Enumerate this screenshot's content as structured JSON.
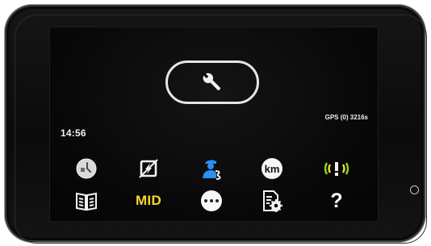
{
  "status": {
    "time": "14:56",
    "gps": "GPS (0) 3216s"
  },
  "main_button": {
    "icon": "wrench-icon"
  },
  "menu": {
    "row1": [
      {
        "icon": "clock-icon"
      },
      {
        "icon": "battery-disabled-icon"
      },
      {
        "icon": "driver-card-icon"
      },
      {
        "label": "km"
      },
      {
        "icon": "vibration-alert-icon"
      }
    ],
    "row2": [
      {
        "icon": "book-icon"
      },
      {
        "label": "MID"
      },
      {
        "icon": "more-icon"
      },
      {
        "icon": "settings-document-icon"
      },
      {
        "label": "?"
      }
    ]
  },
  "colors": {
    "screen_bg": "#080808",
    "text": "#f2f2f2",
    "mid_yellow": "#ffd52a",
    "driver_blue": "#2b8ef0",
    "vibration_green": "#8fd21e",
    "vibration_yellow": "#e8e040"
  }
}
